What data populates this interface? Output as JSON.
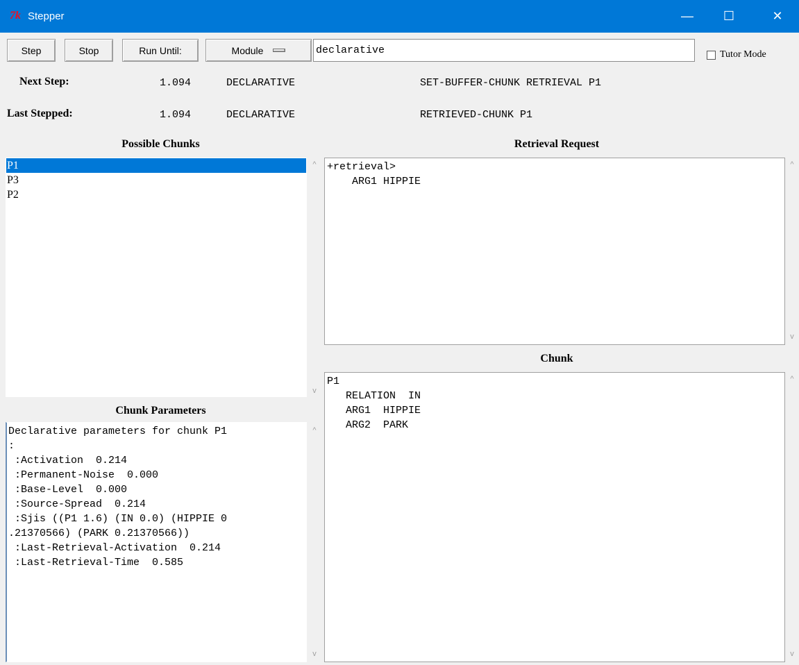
{
  "window": {
    "app_icon": "7k",
    "title": "Stepper",
    "minimize_glyph": "—",
    "maximize_glyph": "☐",
    "close_glyph": "✕"
  },
  "toolbar": {
    "step_label": "Step",
    "stop_label": "Stop",
    "run_until_label": "Run Until:",
    "module_label": "Module",
    "module_value": "declarative",
    "tutor_mode_label": "Tutor Mode",
    "tutor_mode_checked": false
  },
  "next_step": {
    "label": "Next Step:",
    "time": "1.094",
    "module": "DECLARATIVE",
    "action": "SET-BUFFER-CHUNK RETRIEVAL P1"
  },
  "last_stepped": {
    "label": "Last Stepped:",
    "time": "1.094",
    "module": "DECLARATIVE",
    "action": "RETRIEVED-CHUNK P1"
  },
  "possible_chunks": {
    "title": "Possible Chunks",
    "items": [
      "P1",
      "P3",
      "P2"
    ],
    "selected_index": 0
  },
  "retrieval_request": {
    "title": "Retrieval Request",
    "text": "+retrieval>\n    ARG1 HIPPIE"
  },
  "chunk": {
    "title": "Chunk",
    "text": "P1\n   RELATION  IN\n   ARG1  HIPPIE\n   ARG2  PARK"
  },
  "chunk_parameters": {
    "title": "Chunk Parameters",
    "text": "Declarative parameters for chunk P1\n:\n :Activation  0.214\n :Permanent-Noise  0.000\n :Base-Level  0.000\n :Source-Spread  0.214\n :Sjis ((P1 1.6) (IN 0.0) (HIPPIE 0\n.21370566) (PARK 0.21370566))\n :Last-Retrieval-Activation  0.214\n :Last-Retrieval-Time  0.585"
  },
  "scroll_glyphs": {
    "up": "^",
    "down": "v"
  }
}
